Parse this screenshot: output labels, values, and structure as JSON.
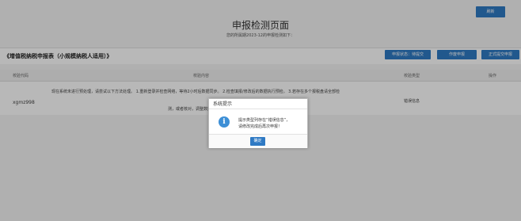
{
  "header": {
    "refresh_label": "刷新",
    "title": "申报检测页面",
    "subtitle": "您的所属期2023-12的申报检测如下："
  },
  "section": {
    "title": "《增值税纳税申报表（小规模纳税人适用）》",
    "buttons": [
      "申报状态：待提交",
      "作废申报",
      "正式提交申报"
    ]
  },
  "table": {
    "columns": [
      "校验代码",
      "校验内容",
      "校验类型",
      "操作"
    ],
    "rows": [
      {
        "code": "xgmz998",
        "content_line1": "现在系统未进行预处理，请尝试以下方法处理。 1.重新登录并检查网络，等待2小时后数据同步。 2.检查填报/修改后的数据执行预检。 3.若存在多个报税盘请全部检",
        "content_line2": "测，或者核对，调整数据后再次申报。",
        "type": "错误信息"
      }
    ]
  },
  "dialog": {
    "title": "系统提示",
    "icon": "info-icon",
    "message_line1": "提示类型列存在“错误信息”，",
    "message_line2": "请修改完成后再次申报！",
    "confirm_label": "确定"
  },
  "colors": {
    "accent": "#2f7ac4",
    "info": "#3d8fd6"
  }
}
